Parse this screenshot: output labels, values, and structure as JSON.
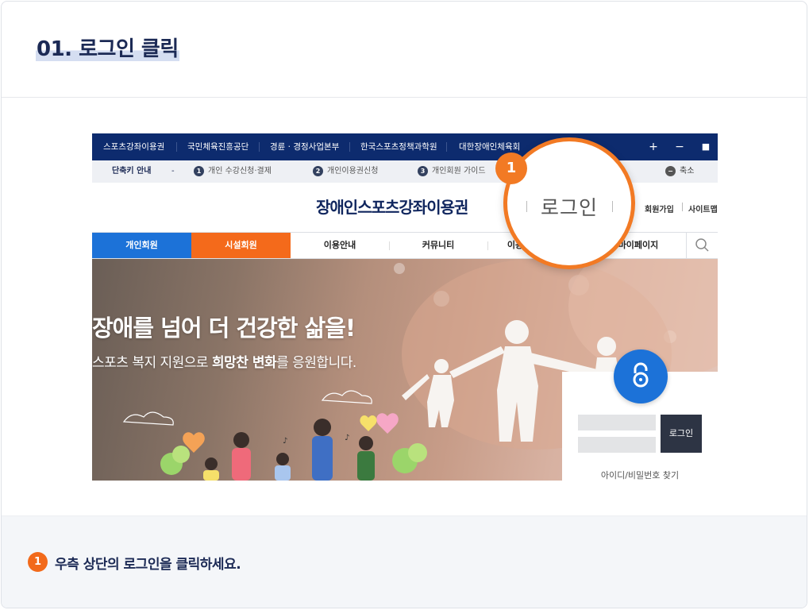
{
  "step": {
    "title": "01. 로그인 클릭"
  },
  "screenshot": {
    "topbar": {
      "links": [
        "스포츠강좌이용권",
        "국민체육진흥공단",
        "경륜 · 경정사업본부",
        "한국스포츠정책과학원",
        "대한장애인체육회"
      ],
      "controls": [
        "+",
        "−",
        "■"
      ]
    },
    "shortcut": {
      "label": "단축키 안내",
      "dash": "-",
      "items": [
        {
          "num": "1",
          "text": "개인 수강신청·결제"
        },
        {
          "num": "2",
          "text": "개인이용권신청"
        },
        {
          "num": "3",
          "text": "개인회원 가이드"
        }
      ],
      "shrink_num": "−",
      "shrink_text": "축소"
    },
    "header": {
      "site_title": "장애인스포츠강좌이용권",
      "links": [
        "회원가입",
        "사이트맵"
      ]
    },
    "nav": {
      "tabs": [
        "개인회원",
        "시설회원",
        "이용안내",
        "커뮤니티",
        "이용",
        "마이페이지"
      ]
    },
    "hero": {
      "title": "장애를 넘어 더 건강한 삶을!",
      "sub_pre": "스포츠 복지 지원으로 ",
      "sub_bold": "희망찬 변화",
      "sub_post": "를 응원합니다."
    },
    "login": {
      "button": "로그인",
      "find": "아이디/비밀번호 찾기"
    }
  },
  "callout": {
    "badge": "1",
    "text": "로그인"
  },
  "instruction": {
    "badge": "1",
    "text": "우측 상단의 로그인을 클릭하세요."
  },
  "colors": {
    "accent": "#f27a24",
    "navy": "#0d2b6e",
    "blue": "#1c72d8",
    "orange_tab": "#f46a1b"
  }
}
